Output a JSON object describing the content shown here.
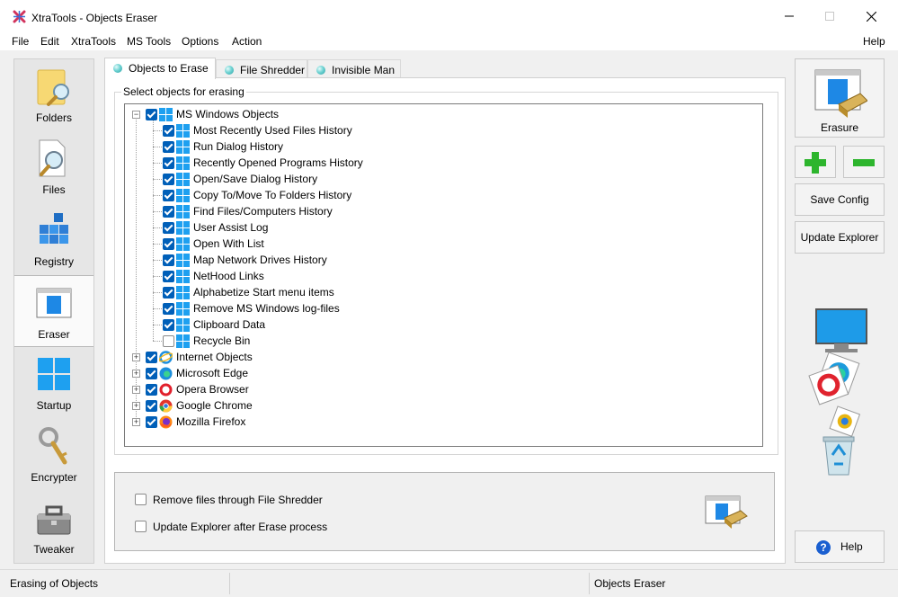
{
  "window": {
    "title": "XtraTools - Objects Eraser"
  },
  "menu": [
    {
      "label": "File"
    },
    {
      "label": "Edit"
    },
    {
      "label": "XtraTools"
    },
    {
      "label": "MS Tools"
    },
    {
      "label": "Options"
    },
    {
      "label": "Action"
    },
    {
      "label": "Help"
    }
  ],
  "sidebar": {
    "items": [
      {
        "label": "Folders",
        "icon": "folder-search-icon"
      },
      {
        "label": "Files",
        "icon": "file-search-icon"
      },
      {
        "label": "Registry",
        "icon": "registry-cubes-icon"
      },
      {
        "label": "Eraser",
        "icon": "eraser-window-icon",
        "active": true
      },
      {
        "label": "Startup",
        "icon": "windows-logo-icon"
      },
      {
        "label": "Encrypter",
        "icon": "key-icon"
      },
      {
        "label": "Tweaker",
        "icon": "toolbox-icon"
      }
    ]
  },
  "tabs": [
    {
      "label": "Objects to Erase",
      "active": true
    },
    {
      "label": "File Shredder"
    },
    {
      "label": "Invisible Man"
    }
  ],
  "objects_group": {
    "label": "Select objects for erasing"
  },
  "tree": {
    "root": {
      "label": "MS Windows Objects",
      "checked": true,
      "expanded": true,
      "children": [
        {
          "label": "Most Recently Used Files History",
          "checked": true
        },
        {
          "label": "Run Dialog History",
          "checked": true
        },
        {
          "label": "Recently Opened Programs History",
          "checked": true
        },
        {
          "label": "Open/Save Dialog History",
          "checked": true
        },
        {
          "label": "Copy To/Move To Folders History",
          "checked": true
        },
        {
          "label": "Find Files/Computers History",
          "checked": true
        },
        {
          "label": "User Assist Log",
          "checked": true
        },
        {
          "label": "Open With List",
          "checked": true
        },
        {
          "label": "Map Network Drives History",
          "checked": true
        },
        {
          "label": "NetHood Links",
          "checked": true
        },
        {
          "label": "Alphabetize Start menu items",
          "checked": true
        },
        {
          "label": "Remove MS Windows log-files",
          "checked": true
        },
        {
          "label": "Clipboard Data",
          "checked": true
        },
        {
          "label": "Recycle Bin",
          "checked": false
        }
      ]
    },
    "others": [
      {
        "label": "Internet Objects",
        "checked": true,
        "icon": "ie-icon"
      },
      {
        "label": "Microsoft Edge",
        "checked": true,
        "icon": "edge-icon"
      },
      {
        "label": "Opera Browser",
        "checked": true,
        "icon": "opera-icon"
      },
      {
        "label": "Google Chrome",
        "checked": true,
        "icon": "chrome-icon"
      },
      {
        "label": "Mozilla Firefox",
        "checked": true,
        "icon": "firefox-icon"
      }
    ]
  },
  "options": {
    "remove_through_shredder": {
      "label": "Remove files through File Shredder",
      "checked": false
    },
    "update_explorer_after": {
      "label": "Update Explorer after Erase process",
      "checked": false
    }
  },
  "right_panel": {
    "erasure_label": "Erasure",
    "save_config_label": "Save Config",
    "update_explorer_label": "Update Explorer",
    "help_label": "Help"
  },
  "status": {
    "left": "Erasing of Objects",
    "right": "Objects Eraser"
  },
  "colors": {
    "accent": "#005fb8",
    "add": "#2db52d",
    "remove": "#2db52d"
  }
}
